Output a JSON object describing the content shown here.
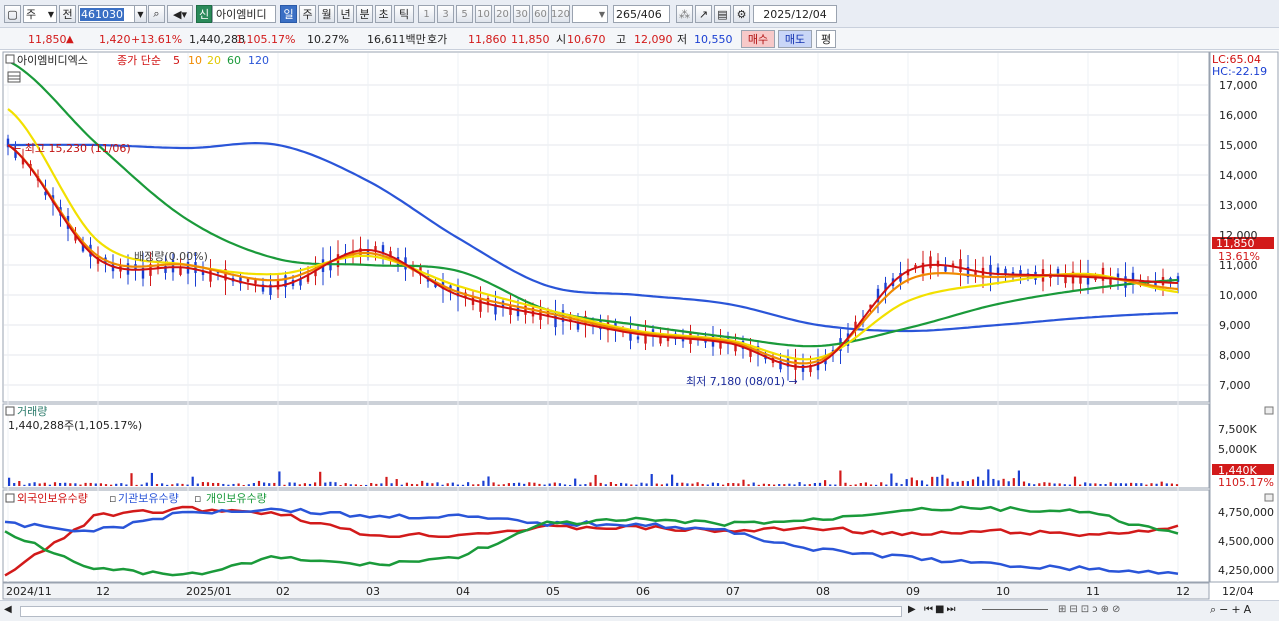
{
  "toolbar": {
    "period_type": "주",
    "prev_label": "전",
    "code": "461030",
    "badge": "신",
    "stock_name": "아이엠비디",
    "period_tabs": [
      "일",
      "주",
      "월",
      "년",
      "분",
      "초",
      "틱"
    ],
    "active_tab": "일",
    "intervals": [
      "1",
      "3",
      "5",
      "10",
      "20",
      "30",
      "60",
      "120"
    ],
    "count": "265",
    "total": "/406",
    "date": "2025/12/04"
  },
  "quote": {
    "price": "11,850",
    "arrow": "▲",
    "change": "1,420",
    "change_pct": "+13.61%",
    "volume": "1,440,288",
    "volume_pct": "1,105.17%",
    "turnover": "10.27%",
    "amount": "16,611백만",
    "ask_label": "호가",
    "ask1": "11,860",
    "ask2": "11,850",
    "open_label": "시",
    "open": "10,670",
    "high_label": "고",
    "high": "12,090",
    "low_label": "저",
    "low": "10,550",
    "buy_button": "매수",
    "sell_button": "매도",
    "eval_button": "평"
  },
  "price_panel": {
    "title": "아이엠비디엑스",
    "ma_label": "종가 단순",
    "ma_periods": [
      "5",
      "10",
      "20",
      "60",
      "120"
    ],
    "lc": "LC:65.04",
    "hc": "HC:-22.19",
    "high_annot": "최고 15,230 (11/06)",
    "low_annot": "최저 7,180 (08/01)",
    "mid_annot": "배정량(0.00%)",
    "price_tag": "11,850",
    "pct_tag": "13.61%",
    "y_ticks": [
      "17,000",
      "16,000",
      "15,000",
      "14,000",
      "13,000",
      "12,000",
      "11,000",
      "10,000",
      "9,000",
      "8,000",
      "7,000"
    ]
  },
  "volume_panel": {
    "title": "거래량",
    "value_label": "1,440,288주(1,105.17%)",
    "y_ticks": [
      "7,500K",
      "5,000K"
    ],
    "value_tag": "1,440K",
    "pct_tag": "1105.17%"
  },
  "holdings_panel": {
    "labels": [
      "외국인보유수량",
      "기관보유수량",
      "개인보유수량"
    ],
    "y_ticks": [
      "4,750,000",
      "4,500,000",
      "4,250,000"
    ]
  },
  "x_axis": {
    "labels": [
      "2024/11",
      "12",
      "2025/01",
      "02",
      "03",
      "04",
      "05",
      "06",
      "07",
      "08",
      "09",
      "10",
      "11",
      "12"
    ],
    "end_label": "12/04"
  },
  "colors": {
    "ma5": "#d01010",
    "ma10": "#f08a00",
    "ma20": "#f2e000",
    "ma60": "#1a9a3a",
    "ma120": "#2a55d8",
    "up": "#d21a1a",
    "down": "#1a3fd2"
  },
  "chart_data": {
    "type": "line",
    "title": "아이엠비디엑스",
    "x": [
      "2024/11",
      "12",
      "2025/01",
      "02",
      "03",
      "04",
      "05",
      "06",
      "07",
      "08",
      "09",
      "10",
      "11",
      "12"
    ],
    "ylim": [
      6500,
      17500
    ],
    "series": [
      {
        "name": "5",
        "values": [
          15000,
          11200,
          10900,
          10300,
          11500,
          10000,
          9300,
          8700,
          8400,
          7700,
          10800,
          10700,
          10600,
          10400
        ]
      },
      {
        "name": "10",
        "values": [
          15000,
          11300,
          11000,
          10500,
          11400,
          10100,
          9400,
          8750,
          8450,
          7800,
          10500,
          10600,
          10650,
          10200
        ]
      },
      {
        "name": "20",
        "values": [
          16200,
          11800,
          11000,
          10700,
          11300,
          10300,
          9500,
          8800,
          8500,
          7900,
          9800,
          10400,
          10700,
          10100
        ]
      },
      {
        "name": "60",
        "values": [
          17800,
          15000,
          12500,
          11200,
          11000,
          10800,
          9500,
          9000,
          8600,
          8300,
          8900,
          9700,
          10200,
          10500
        ]
      },
      {
        "name": "120",
        "values": [
          15000,
          15000,
          14900,
          15000,
          13800,
          11900,
          10300,
          10000,
          9700,
          9000,
          8800,
          9000,
          9250,
          9400
        ]
      }
    ]
  }
}
